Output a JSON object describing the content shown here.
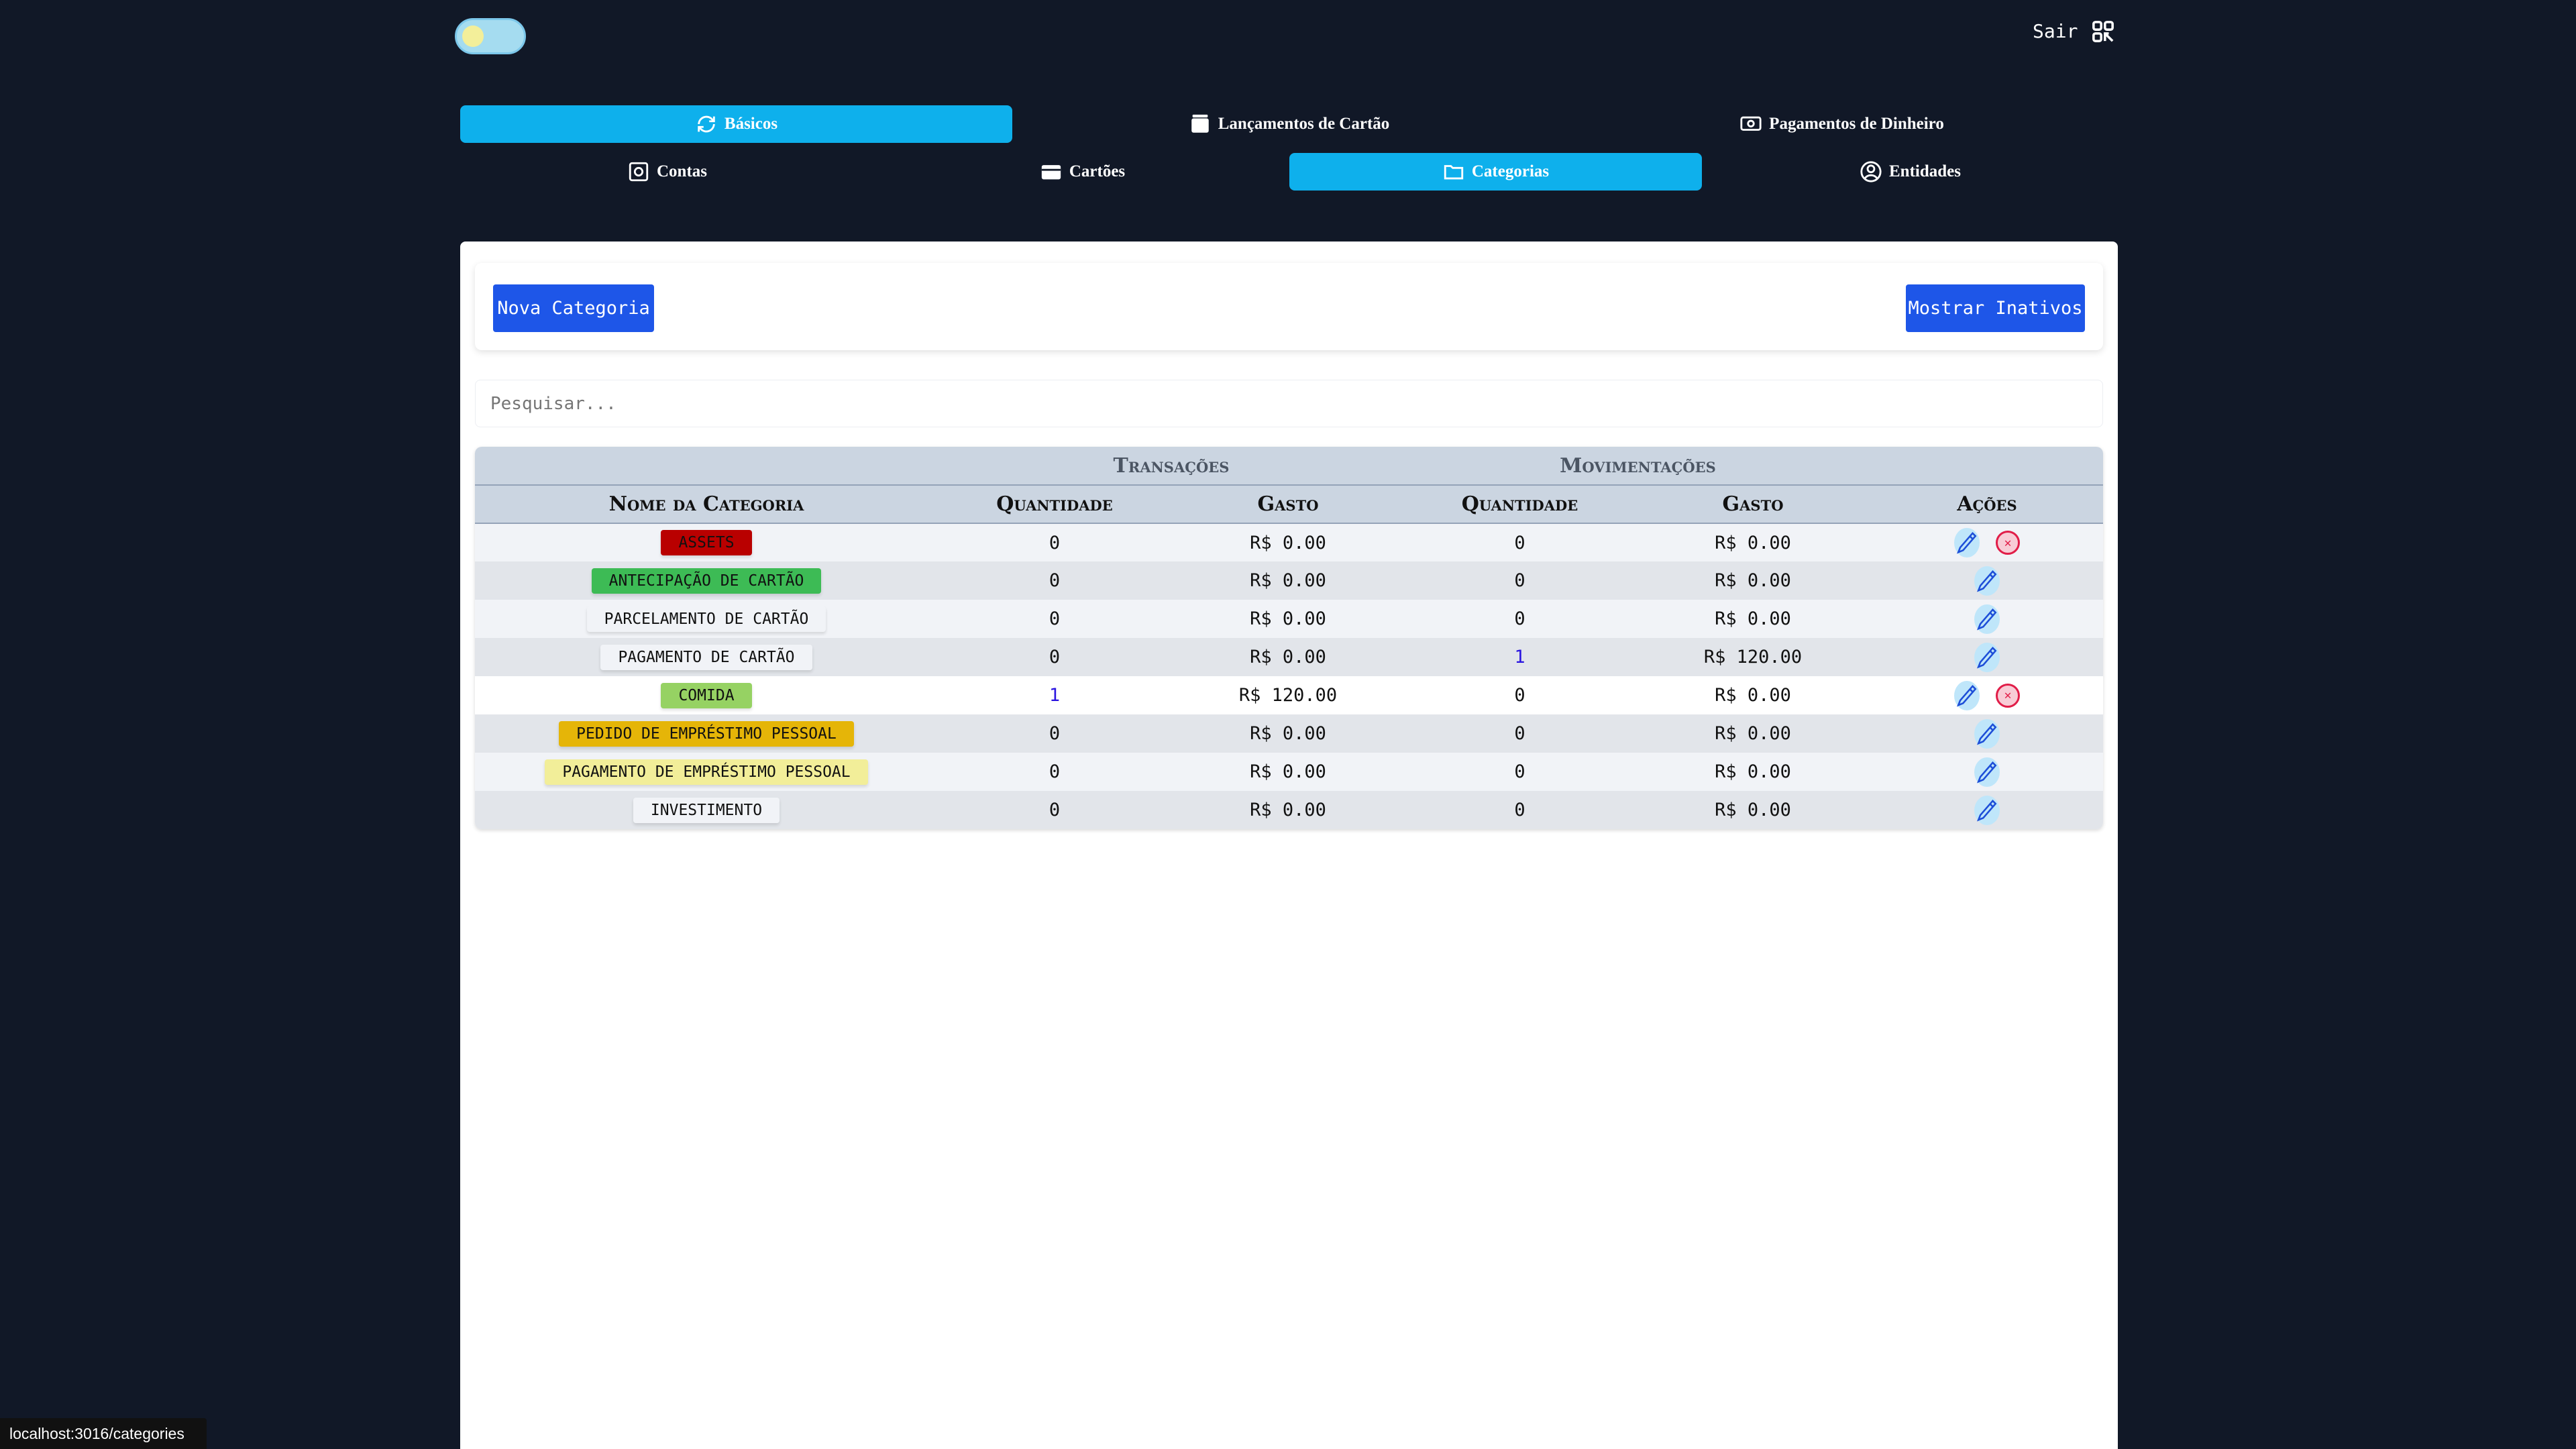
{
  "header": {
    "logout_label": "Sair",
    "qr_icon": "qr-code-icon"
  },
  "nav": {
    "row1": [
      {
        "label": "Básicos",
        "icon": "refresh-icon",
        "active": true
      },
      {
        "label": "Lançamentos de Cartão",
        "icon": "wallet-icon",
        "active": false
      },
      {
        "label": "Pagamentos de Dinheiro",
        "icon": "cash-icon",
        "active": false
      }
    ],
    "row2": [
      {
        "label": "Contas",
        "icon": "vault-icon",
        "active": false
      },
      {
        "label": "Cartões",
        "icon": "credit-card-icon",
        "active": false
      },
      {
        "label": "Categorias",
        "icon": "folder-icon",
        "active": true
      },
      {
        "label": "Entidades",
        "icon": "user-circle-icon",
        "active": false
      }
    ]
  },
  "toolbar": {
    "new_label": "Nova Categoria",
    "show_inactive_label": "Mostrar Inativos"
  },
  "search": {
    "placeholder": "Pesquisar..."
  },
  "table": {
    "groups": [
      "Transações",
      "Movimentações"
    ],
    "columns": [
      "Nome da Categoria",
      "Quantidade",
      "Gasto",
      "Quantidade",
      "Gasto",
      "Ações"
    ],
    "rows": [
      {
        "name": "ASSETS",
        "color": "#b90000",
        "tx_qty": "0",
        "tx_spent": "R$ 0.00",
        "mv_qty": "0",
        "mv_spent": "R$ 0.00",
        "deletable": true
      },
      {
        "name": "ANTECIPAÇÃO DE CARTÃO",
        "color": "#3dbb55",
        "tx_qty": "0",
        "tx_spent": "R$ 0.00",
        "mv_qty": "0",
        "mv_spent": "R$ 0.00",
        "deletable": false
      },
      {
        "name": "PARCELAMENTO DE CARTÃO",
        "color": "#f1f3f7",
        "tx_qty": "0",
        "tx_spent": "R$ 0.00",
        "mv_qty": "0",
        "mv_spent": "R$ 0.00",
        "deletable": false
      },
      {
        "name": "PAGAMENTO DE CARTÃO",
        "color": "#f1f3f7",
        "tx_qty": "0",
        "tx_spent": "R$ 0.00",
        "mv_qty": "1",
        "mv_spent": "R$ 120.00",
        "deletable": false
      },
      {
        "name": "COMIDA",
        "color": "#96d263",
        "tx_qty": "1",
        "tx_spent": "R$ 120.00",
        "mv_qty": "0",
        "mv_spent": "R$ 0.00",
        "deletable": true
      },
      {
        "name": "PEDIDO DE EMPRÉSTIMO PESSOAL",
        "color": "#e5b508",
        "tx_qty": "0",
        "tx_spent": "R$ 0.00",
        "mv_qty": "0",
        "mv_spent": "R$ 0.00",
        "deletable": false
      },
      {
        "name": "PAGAMENTO DE EMPRÉSTIMO PESSOAL",
        "color": "#f2ee99",
        "tx_qty": "0",
        "tx_spent": "R$ 0.00",
        "mv_qty": "0",
        "mv_spent": "R$ 0.00",
        "deletable": false
      },
      {
        "name": "INVESTIMENTO",
        "color": "#f1f3f7",
        "tx_qty": "0",
        "tx_spent": "R$ 0.00",
        "mv_qty": "0",
        "mv_spent": "R$ 0.00",
        "deletable": false
      }
    ]
  },
  "status_bar": {
    "url": "localhost:3016/categories"
  }
}
